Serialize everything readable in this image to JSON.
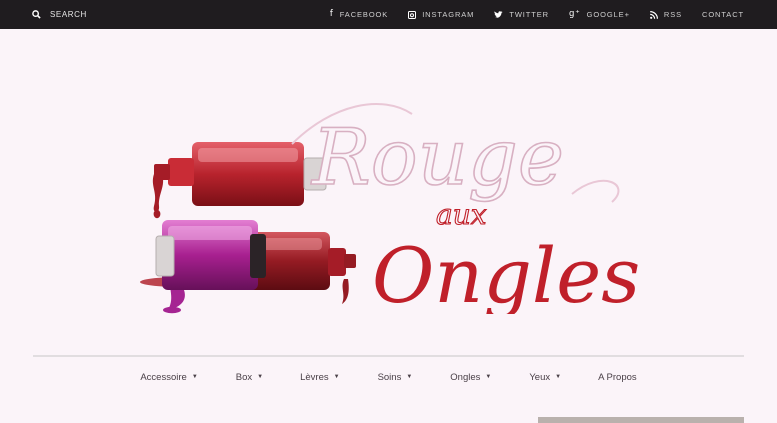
{
  "topbar": {
    "search_label": "SEARCH",
    "social": [
      {
        "icon": "facebook-icon",
        "glyph": "f",
        "label": "FACEBOOK"
      },
      {
        "icon": "instagram-icon",
        "glyph": "",
        "label": "INSTAGRAM"
      },
      {
        "icon": "twitter-icon",
        "glyph": "",
        "label": "TWITTER"
      },
      {
        "icon": "google-plus-icon",
        "glyph": "g+",
        "label": "GOOGLE+"
      },
      {
        "icon": "rss-icon",
        "glyph": "",
        "label": "RSS"
      },
      {
        "icon": "contact-icon",
        "glyph": "",
        "label": "CONTACT"
      }
    ]
  },
  "logo": {
    "word1": "Rouge",
    "word2": "aux",
    "word3": "Ongles"
  },
  "nav": {
    "items": [
      {
        "label": "Accessoire",
        "dropdown": true
      },
      {
        "label": "Box",
        "dropdown": true
      },
      {
        "label": "Lèvres",
        "dropdown": true
      },
      {
        "label": "Soins",
        "dropdown": true
      },
      {
        "label": "Ongles",
        "dropdown": true
      },
      {
        "label": "Yeux",
        "dropdown": true
      },
      {
        "label": "A Propos",
        "dropdown": false
      }
    ]
  },
  "colors": {
    "topbar_bg": "#1f1c1f",
    "page_bg": "#fbf4f9",
    "logo_red": "#c0202a",
    "polish_purple": "#a01f86"
  }
}
